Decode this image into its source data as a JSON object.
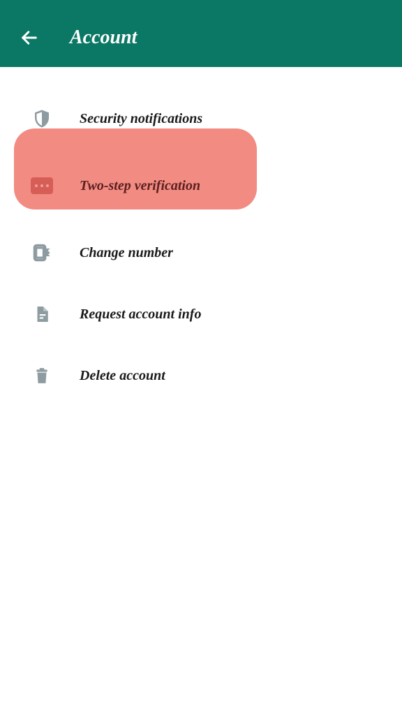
{
  "header": {
    "title": "Account"
  },
  "menu": {
    "items": [
      {
        "label": "Security notifications"
      },
      {
        "label": "Two-step verification"
      },
      {
        "label": "Change number"
      },
      {
        "label": "Request account info"
      },
      {
        "label": "Delete account"
      }
    ]
  },
  "colors": {
    "headerBg": "#0a7864",
    "highlight": "#f28b82",
    "iconGray": "#8e9ca1"
  }
}
